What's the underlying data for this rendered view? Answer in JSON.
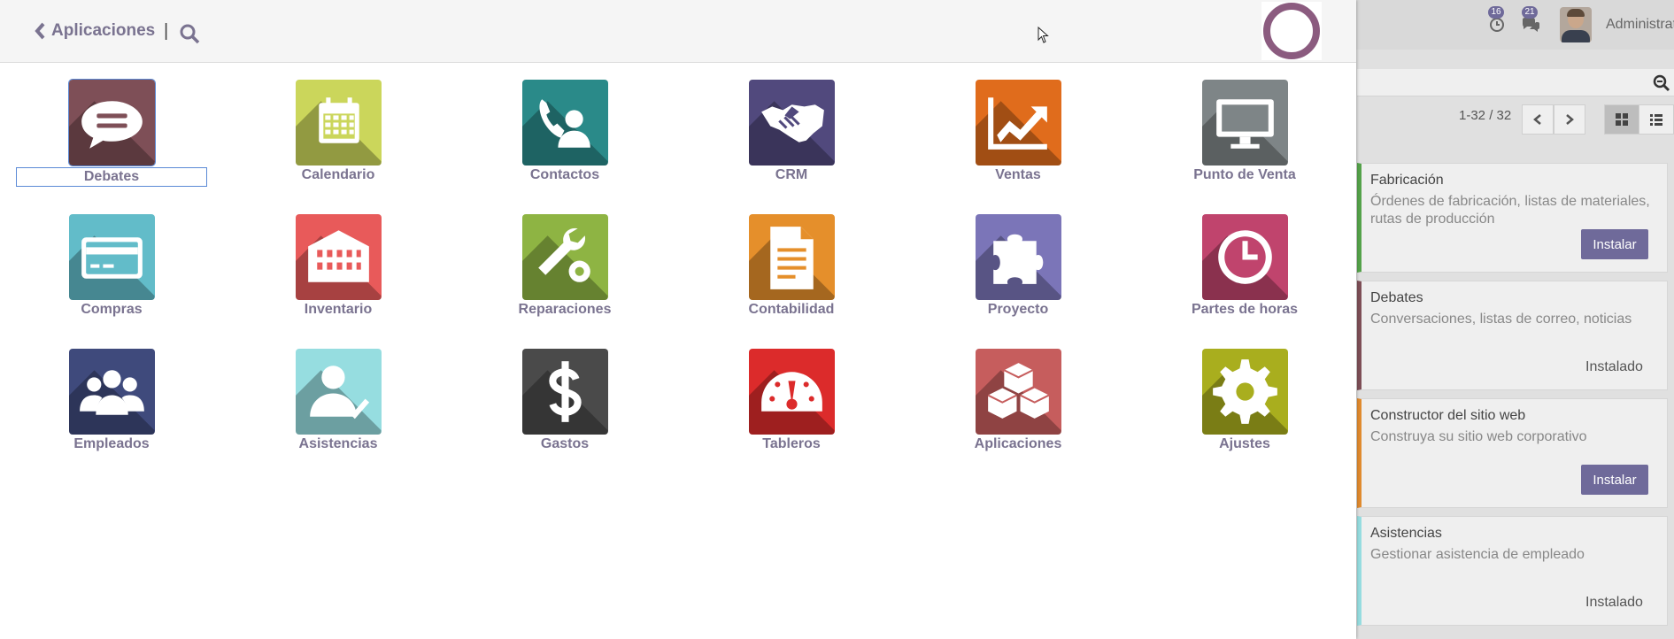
{
  "header": {
    "back_label": "Aplicaciones",
    "separator": "|"
  },
  "apps": [
    {
      "label": "Debates",
      "color": "#7e4f57",
      "icon": "chat-bubble-icon"
    },
    {
      "label": "Calendario",
      "color": "#cbd65b",
      "icon": "calendar-icon"
    },
    {
      "label": "Contactos",
      "color": "#2a8a89",
      "icon": "contact-phone-icon"
    },
    {
      "label": "CRM",
      "color": "#51497d",
      "icon": "handshake-icon"
    },
    {
      "label": "Ventas",
      "color": "#e06c1c",
      "icon": "chart-up-icon"
    },
    {
      "label": "Punto de Venta",
      "color": "#7e8587",
      "icon": "monitor-icon"
    },
    {
      "label": "Compras",
      "color": "#62bcc9",
      "icon": "credit-card-icon"
    },
    {
      "label": "Inventario",
      "color": "#e85a5a",
      "icon": "warehouse-icon"
    },
    {
      "label": "Reparaciones",
      "color": "#8eb443",
      "icon": "wrench-gear-icon"
    },
    {
      "label": "Contabilidad",
      "color": "#e58f2b",
      "icon": "document-icon"
    },
    {
      "label": "Proyecto",
      "color": "#7b75b8",
      "icon": "puzzle-icon"
    },
    {
      "label": "Partes de horas",
      "color": "#c0446d",
      "icon": "clock-icon"
    },
    {
      "label": "Empleados",
      "color": "#3f4a7c",
      "icon": "group-users-icon"
    },
    {
      "label": "Asistencias",
      "color": "#96dde0",
      "icon": "user-check-icon"
    },
    {
      "label": "Gastos",
      "color": "#4a4a4a",
      "icon": "dollar-icon"
    },
    {
      "label": "Tableros",
      "color": "#dc2b2b",
      "icon": "dashboard-gauge-icon"
    },
    {
      "label": "Aplicaciones",
      "color": "#c65d5d",
      "icon": "cubes-icon"
    },
    {
      "label": "Ajustes",
      "color": "#a9ae1e",
      "icon": "settings-gear-icon"
    }
  ],
  "background": {
    "activity_count": "16",
    "message_count": "21",
    "username": "Administrat",
    "pager": "1-32 / 32",
    "cards": [
      {
        "title": "Fabricación",
        "description": "Órdenes de fabricación, listas de materiales, rutas de producción",
        "action": "Instalar",
        "installed": false,
        "accent": "#55a34a"
      },
      {
        "title": "Debates",
        "description": "Conversaciones, listas de correo, noticias",
        "action": "Instalado",
        "installed": true,
        "accent": "#7e4f57"
      },
      {
        "title": "Constructor del sitio web",
        "description": "Construya su sitio web corporativo",
        "action": "Instalar",
        "installed": false,
        "accent": "#e08a2e"
      },
      {
        "title": "Asistencias",
        "description": "Gestionar asistencia de empleado",
        "action": "Instalado",
        "installed": true,
        "accent": "#96dde0"
      }
    ]
  }
}
